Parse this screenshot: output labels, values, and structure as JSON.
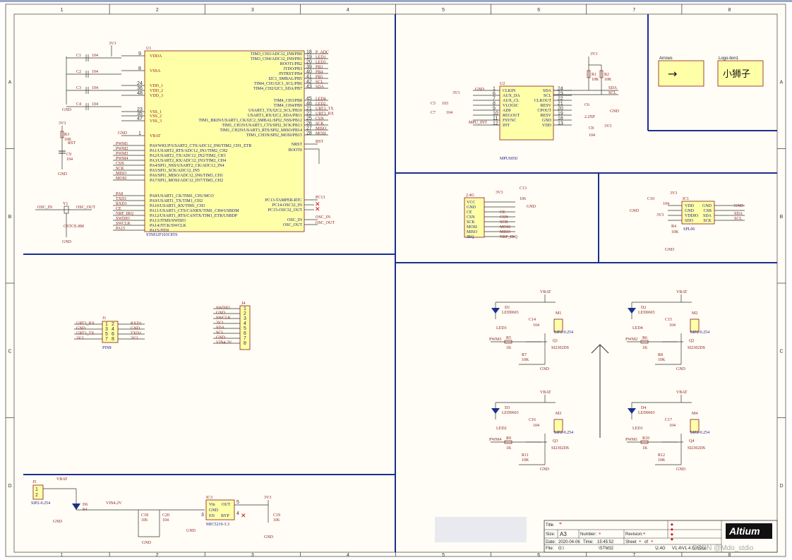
{
  "border": {
    "cols": [
      "1",
      "2",
      "3",
      "4",
      "5",
      "6",
      "7",
      "8"
    ],
    "rows": [
      "A",
      "B",
      "C",
      "D"
    ]
  },
  "mcu": {
    "ref": "U1",
    "part": "STM32F103C8T6",
    "left_pins": [
      "VDDA",
      "VSSA",
      "VDD_1",
      "VDD_2",
      "VDD_3",
      "VSS_1",
      "VSS_2",
      "VSS_3",
      "VBAT"
    ],
    "left_pin_nums": [
      "9",
      "8",
      "24",
      "36",
      "48",
      "23",
      "35",
      "47",
      "1"
    ],
    "left_io": [
      "PA0/WKUP/USART2_CTS/ADC12_IN0/TIM2_CH1_ETR",
      "PA1/USART2_RTS/ADC12_IN1/TIM2_CH2",
      "PA2/USART2_TX/ADC12_IN2/TIM2_CH3",
      "PA3/USART2_RX/ADC12_IN3/TIM2_CH4",
      "PA4/SPI1_NSS/USART2_CK/ADC12_IN4",
      "PA5/SPI1_SCK/ADC12_IN5",
      "PA6/SPI1_MISO/ADC12_IN6/TIM3_CH1",
      "PA7/SPI1_MOSI/ADC12_IN7/TIM3_CH2",
      "PA8/USART1_CK/TIM1_CH1/MCO",
      "PA9/USART1_TX/TIM1_CH2",
      "PA10/USART1_RX/TIM1_CH3",
      "PA11/USART1_CTS/CANRX/TIM1_CH4/USBDM",
      "PA12/USART1_RTS/CANTX/TIM1_ETR/USBDP",
      "PA13/JTMS/SWDIO",
      "PA14/JTCK/SWCLK",
      "PA15/JTDI"
    ],
    "left_nets": [
      "PWM1",
      "PWM2",
      "PWM3",
      "PWM4",
      "CSN",
      "SCK",
      "MISO",
      "MOSI",
      "PA8",
      "TXD1",
      "RXD1",
      "CE",
      "NRF_IRQ",
      "SWDIO",
      "SWCLK",
      "PA15"
    ],
    "right_io": [
      "TIM3_CH3/ADC12_IN8/PB0",
      "TIM3_CH4/ADC12_IN9/PB1",
      "BOOT1/PB2",
      "JTDO/PB3",
      "JNTRST/PB4",
      "I2C1_SMBAL/PB5",
      "TIM4_CH1/I2C1_SCL/PB6",
      "TIM4_CH2/I2C1_SDA/PB7",
      "TIM4_CH3/PB8",
      "TIM4_CH4/PB9",
      "USART3_TX/I2C2_SCL/PB10",
      "USART3_RX/I2C2_SDA/PB11",
      "TIM1_BKIN/USART3_CK/I2C2_SMBAL/SPI2_NSS/PB12",
      "TIM1_CH1N/USART3_CTS/SPI2_SCK/PB13",
      "TIM1_CH2N/USART3_RTS/SPI2_MISO/PB14",
      "TIM1_CH3N/SPI2_MOSI/PB15"
    ],
    "right_nets": [
      "P_ADC",
      "LED1",
      "LED3",
      "PB3",
      "PB4",
      "PB5",
      "SCL",
      "SDA",
      "LED4",
      "LED2",
      "URT3_TX",
      "URT3_RX",
      "CSN",
      "SCK",
      "MISO",
      "MOSI"
    ],
    "right_nums": [
      "18",
      "19",
      "20",
      "39",
      "40",
      "41",
      "42",
      "43",
      "45",
      "46",
      "21",
      "22",
      "25",
      "26",
      "27",
      "28"
    ],
    "nrst": "NRST",
    "boot0": "BOOT0",
    "pc13": "PC13-TAMPER-RTC",
    "pc14": "PC14-OSC32_IN",
    "pc15": "PC15-OSC32_OUT",
    "osc_in": "OSC_IN",
    "osc_out": "OSC_OUT",
    "net_rst": "RST",
    "net_pc13": "PC13",
    "net_osc_in": "OSC_IN",
    "net_osc_out": "OSC_OUT"
  },
  "power": {
    "v33": "3V3",
    "gnd": "GND",
    "vbat": "VBAT",
    "vin": "VIN4.2V"
  },
  "caps_left": [
    {
      "ref": "C1",
      "val": "104"
    },
    {
      "ref": "C2",
      "val": "104"
    },
    {
      "ref": "C3",
      "val": "104"
    },
    {
      "ref": "C4",
      "val": "104"
    }
  ],
  "reset": {
    "r": "R3",
    "rval": "10K",
    "c": "C9",
    "cval": "104",
    "net": "RST"
  },
  "crystal": {
    "ref": "Y1",
    "part": "CSTCE-8M",
    "in": "OSC_IN",
    "out": "OSC_OUT"
  },
  "mpu": {
    "ref": "U2",
    "part": "MPU6050",
    "left_pins": [
      "CLKIN",
      "AUX_DA",
      "AUX_CL",
      "VLOGIC",
      "AD0",
      "REGOUT",
      "FSYNC",
      "INT"
    ],
    "left_nums": [
      "1",
      "6",
      "7",
      "8",
      "9",
      "10",
      "11",
      "12"
    ],
    "right_pins": [
      "SDA",
      "SCL",
      "CLKOUT",
      "RESV",
      "CPOUT",
      "RESV",
      "GND",
      "VDD"
    ],
    "right_nums": [
      "24",
      "23",
      "22",
      "21",
      "20",
      "19",
      "18",
      "13"
    ],
    "int_net": "MPU_INT",
    "r1": "R1",
    "r1v": "10K",
    "r2": "R2",
    "r2v": "10K",
    "c5": "C5",
    "c5v": "103",
    "c7": "C7",
    "c7v": "104",
    "c6": "C6",
    "c6v": "2.2NF",
    "c8": "C8",
    "c8v": "104",
    "sda": "SDA",
    "scl": "SCL"
  },
  "nrf": {
    "ref": "2.4G",
    "pins": [
      "VCC",
      "GND",
      "CE",
      "CSN",
      "SCK",
      "MOSI",
      "MISO",
      "IRQ"
    ],
    "nets": [
      "",
      "",
      "CE",
      "CSN",
      "SCK",
      "MOSI",
      "MISO",
      "NRF_IRQ"
    ],
    "c13": "C13",
    "c13v": "106"
  },
  "spl": {
    "ref": "IC1",
    "part": "SPL06",
    "left_pins": [
      "VDD",
      "GND",
      "VDDIO",
      "SDO"
    ],
    "right_pins": [
      "GND",
      "CSB",
      "SDA",
      "SCK"
    ],
    "c10": "C10",
    "c10v": "104",
    "r4": "R4",
    "r4v": "10K",
    "sda": "SDA",
    "scl": "SCL"
  },
  "j1": {
    "ref": "J1",
    "part": "PIN8",
    "left": [
      "URT3_RX",
      "GND",
      "URT3_TX",
      "3V3"
    ],
    "right": [
      "RXD1",
      "GND",
      "TXD1",
      "3V3"
    ],
    "nums_l": [
      "1",
      "3",
      "5",
      "7"
    ],
    "nums_r": [
      "2",
      "4",
      "6",
      "8"
    ]
  },
  "j4": {
    "ref": "J4",
    "nets": [
      "SWDIO",
      "GND",
      "SWCLK",
      "3V3",
      "SDA",
      "SCL",
      "GND",
      "VIN4.2V"
    ],
    "nums": [
      "1",
      "2",
      "3",
      "4",
      "5",
      "6",
      "7",
      "8"
    ]
  },
  "motors": [
    {
      "d": "D1",
      "dp": "LED0603",
      "led": "LED3",
      "m": "M1",
      "mp": "SIP2-0.254",
      "c": "C14",
      "cv": "104",
      "pwm": "PWM3",
      "r": "R5",
      "rv": "1K",
      "r2": "R7",
      "r2v": "10K",
      "q": "Q1",
      "qp": "SI2302DS"
    },
    {
      "d": "D2",
      "dp": "LED0603",
      "led": "LED4",
      "m": "M2",
      "mp": "SIP2-0.254",
      "c": "C15",
      "cv": "104",
      "pwm": "PWM2",
      "r": "R6",
      "rv": "1K",
      "r2": "R8",
      "r2v": "10K",
      "q": "Q2",
      "qp": "SI2302DS"
    },
    {
      "d": "D3",
      "dp": "LED0603",
      "led": "LED2",
      "m": "M3",
      "mp": "SIP2-0.254",
      "c": "C16",
      "cv": "104",
      "pwm": "PWM4",
      "r": "R9",
      "rv": "1K",
      "r2": "R11",
      "r2v": "10K",
      "q": "Q3",
      "qp": "SI2302DS"
    },
    {
      "d": "D4",
      "dp": "LED0603",
      "led": "LED1",
      "m": "M4",
      "mp": "SIP2-0.254",
      "c": "C17",
      "cv": "104",
      "pwm": "PWM1",
      "r": "R10",
      "rv": "1K",
      "r2": "R12",
      "r2v": "10K",
      "q": "Q4",
      "qp": "SI2302DS"
    }
  ],
  "arrows_box": {
    "title": "Arrows",
    "glyph": "→"
  },
  "logo_box": {
    "title": "Logo-lion1",
    "text": "小狮子"
  },
  "psu": {
    "j5": "J5",
    "j5p": "SIP2-0.254",
    "d6": "D6",
    "d6v": "S4",
    "ic": "IC3",
    "icp": "MIC5219-3.3",
    "vin": "Vin",
    "out": "OUT",
    "gnd": "GND",
    "en": "EN",
    "byp": "BYP",
    "c18": "C18",
    "c18v": "106",
    "c20": "C20",
    "c20v": "104",
    "c19": "C19",
    "c19v": "106",
    "pin1": "1",
    "pin2": "2",
    "pin3": "3",
    "pin4": "4",
    "pin5": "5"
  },
  "title_block": {
    "title_label": "Title",
    "title_val": "*",
    "size_label": "Size:",
    "size_val": "A3",
    "number_label": "Number:",
    "number_val": "*",
    "revision_label": "Revision:",
    "revision_val": "*",
    "date_label": "Date:",
    "date_val": "2020-04-06",
    "time_label": "Time:",
    "time_val": "15:45:52",
    "sheet_label": "Sheet",
    "sheet_val": "*",
    "of_label": "of",
    "of_val": "*",
    "file_label": "File:",
    "file_val": "G:\\",
    "file_mid": "\\STM32",
    "file_mid2": "\\2.4G",
    "file_end": "V1.4\\V1.4.SchDoc",
    "brand": "Altium",
    "watermark": "CSDN @Mdo_stdio"
  }
}
